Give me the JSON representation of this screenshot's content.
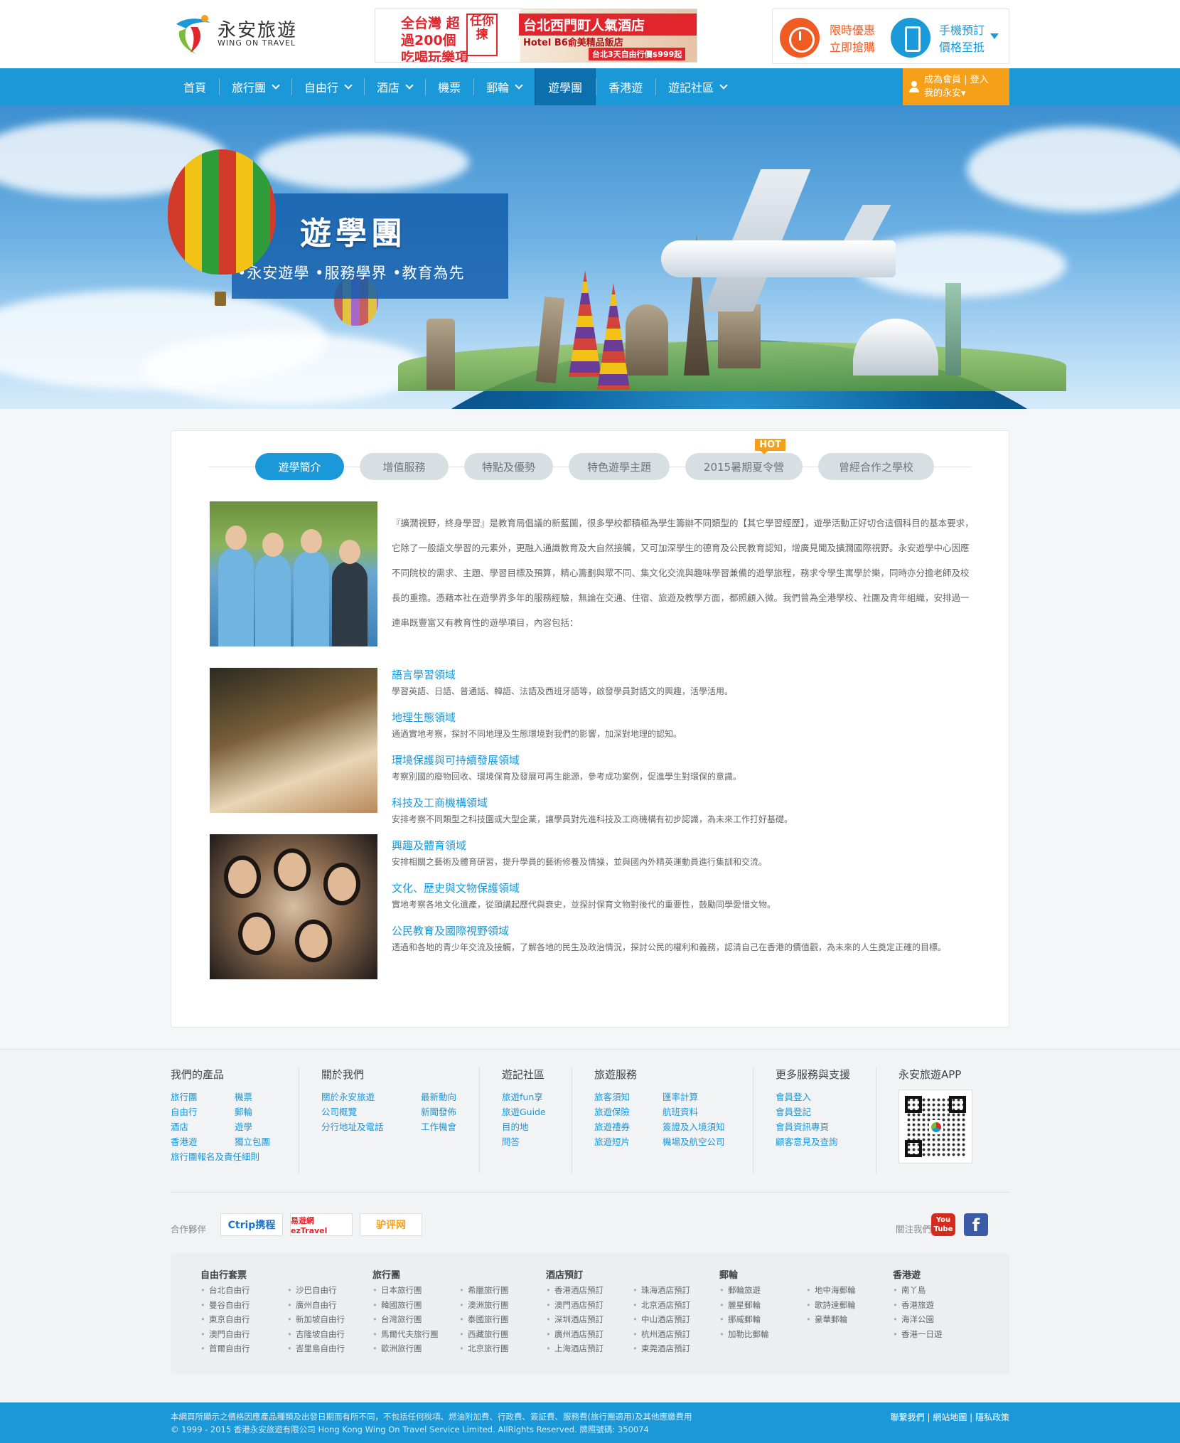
{
  "header": {
    "brand_zh": "永安旅遊",
    "brand_en": "WING ON TRAVEL",
    "ad": {
      "left": "全台灣 超過200個 吃喝玩樂項目",
      "badge": "任你揀",
      "right": "台北西門町人氣酒店",
      "sub": "Hotel B6俞美精品飯店",
      "price": "台北3天自由行價$999起"
    },
    "promo1": "限時優惠 立即搶購",
    "promo2": "手機預訂 價格至抵"
  },
  "nav": {
    "items": [
      "首頁",
      "旅行團",
      "自由行",
      "酒店",
      "機票",
      "郵輪",
      "遊學團",
      "香港遊",
      "遊記社區"
    ],
    "member_line1": "成為會員 | 登入",
    "member_line2": "我的永安▾"
  },
  "banner": {
    "title": "遊學團",
    "slogan": "•永安遊學  •服務學界  •教育為先"
  },
  "tabs": [
    "遊學簡介",
    "增值服務",
    "特點及優勢",
    "特色遊學主題",
    "2015暑期夏令營",
    "曾經合作之學校"
  ],
  "hot_label": "HOT",
  "intro": "『擴濶視野，終身學習』是教育局倡議的新藍圖，很多學校都積極為學生籌辦不同類型的【其它學習經歷】，遊學活動正好切合這個科目的基本要求，它除了一般語文學習的元素外，更融入通識教育及大自然接觸，又可加深學生的德育及公民教育認知，增廣見聞及擴濶國際視野。永安遊學中心因應不同院校的需求、主題、學習目標及預算，精心籌劃與眾不同、集文化交流與趣味學習兼備的遊學旅程，務求令學生寓學於樂，同時亦分擔老師及校長的重擔。憑藉本社在遊學界多年的服務經驗，無論在交通、住宿、旅遊及教學方面，都照顧入微。我們曾為全港學校、社團及青年組織，安排過一連串既豐富又有教育性的遊學項目，內容包括：",
  "areas": [
    {
      "title": "語言學習領域",
      "desc": "學習英語、日語、普通話、韓語、法語及西班牙語等，啟發學員對語文的興趣，活學活用。"
    },
    {
      "title": "地理生態領域",
      "desc": "通過實地考察，探討不同地理及生態環境對我們的影響，加深對地理的認知。"
    },
    {
      "title": "環境保護與可持續發展領域",
      "desc": "考察別國的廢物回收、環境保育及發展可再生能源，參考成功案例，促進學生對環保的意識。"
    },
    {
      "title": "科技及工商機構領域",
      "desc": "安排考察不同類型之科技園或大型企業，讓學員對先進科技及工商機構有初步認識，為未來工作打好基礎。"
    },
    {
      "title": "興趣及體育領域",
      "desc": "安排相關之藝術及體育研習，提升學員的藝術修養及情操，並與國內外精英運動員進行集訓和交流。"
    },
    {
      "title": "文化、歷史與文物保護領域",
      "desc": "實地考察各地文化遺產，從頭講起歷代與衰史，並探討保育文物對後代的重要性，鼓勵同學愛惜文物。"
    },
    {
      "title": "公民教育及國際視野領域",
      "desc": "透過和各地的青少年交流及接觸，了解各地的民生及政治情況，探討公民的權利和義務，認清自己在香港的價值觀，為未來的人生奠定正確的目標。"
    }
  ],
  "footer": {
    "cols": [
      {
        "title": "我們的產品",
        "links": [
          "旅行團",
          "機票",
          "自由行",
          "郵輪",
          "酒店",
          "遊學",
          "香港遊",
          "獨立包團",
          "旅行團報名及責任細則"
        ]
      },
      {
        "title": "關於我們",
        "links": [
          "關於永安旅遊",
          "最新動向",
          "公司概覽",
          "新聞發佈",
          "分行地址及電話",
          "工作機會"
        ]
      },
      {
        "title": "遊記社區",
        "links": [
          "旅遊fun享",
          "旅遊Guide",
          "目的地",
          "問答"
        ]
      },
      {
        "title": "旅遊服務",
        "links": [
          "旅客須知",
          "匯率計算",
          "旅遊保險",
          "航班資料",
          "旅遊禮券",
          "簽證及入境須知",
          "旅遊短片",
          "機場及航空公司"
        ]
      },
      {
        "title": "更多服務與支援",
        "links": [
          "會員登入",
          "會員登記",
          "會員資訊專頁",
          "顧客意見及查詢"
        ]
      },
      {
        "title": "永安旅遊APP",
        "links": []
      }
    ],
    "partners_label": "合作夥伴",
    "partners": [
      "Ctrip携程",
      "易遊網 ezTravel",
      "驴评网"
    ],
    "follow_label": "關注我們",
    "youtube": "You Tube",
    "facebook": "f",
    "sitemap": [
      {
        "title": "自由行套票",
        "links": [
          "台北自由行",
          "沙巴自由行",
          "曼谷自由行",
          "廣州自由行",
          "東京自由行",
          "新加坡自由行",
          "澳門自由行",
          "吉隆坡自由行",
          "首爾自由行",
          "峇里島自由行"
        ]
      },
      {
        "title": "旅行團",
        "links": [
          "日本旅行團",
          "希臘旅行團",
          "韓國旅行團",
          "澳洲旅行團",
          "台灣旅行團",
          "泰國旅行團",
          "馬爾代夫旅行團",
          "西藏旅行團",
          "歐洲旅行團",
          "北京旅行團"
        ]
      },
      {
        "title": "酒店預訂",
        "links": [
          "香港酒店預訂",
          "珠海酒店預訂",
          "澳門酒店預訂",
          "北京酒店預訂",
          "深圳酒店預訂",
          "中山酒店預訂",
          "廣州酒店預訂",
          "杭州酒店預訂",
          "上海酒店預訂",
          "東莞酒店預訂"
        ]
      },
      {
        "title": "郵輪",
        "links": [
          "郵輪旅遊",
          "地中海郵輪",
          "麗星郵輪",
          "歌詩達郵輪",
          "挪威郵輪",
          "豪華郵輪",
          "加勒比郵輪"
        ]
      },
      {
        "title": "香港遊",
        "links": [
          "南丫島",
          "香港旅遊",
          "海洋公園",
          "香港一日遊"
        ]
      }
    ],
    "disclaimer": "本網頁所顯示之價格因應產品種類及出發日期而有所不同，不包括任何稅項、燃油附加費、行政費、簽証費、服務費(旅行團適用)及其他應繳費用",
    "copyright": "© 1999 - 2015 香港永安旅遊有限公司 Hong Kong Wing On Travel Service Limited. AllRights Reserved. 牌照號碼: 350074",
    "bottom_links": "聯繫我們 | 網站地圖 | 隱私政策"
  },
  "colors": {
    "brand_blue": "#1b98d8",
    "accent_orange": "#f6a01a",
    "promo_orange": "#ef5b22"
  }
}
